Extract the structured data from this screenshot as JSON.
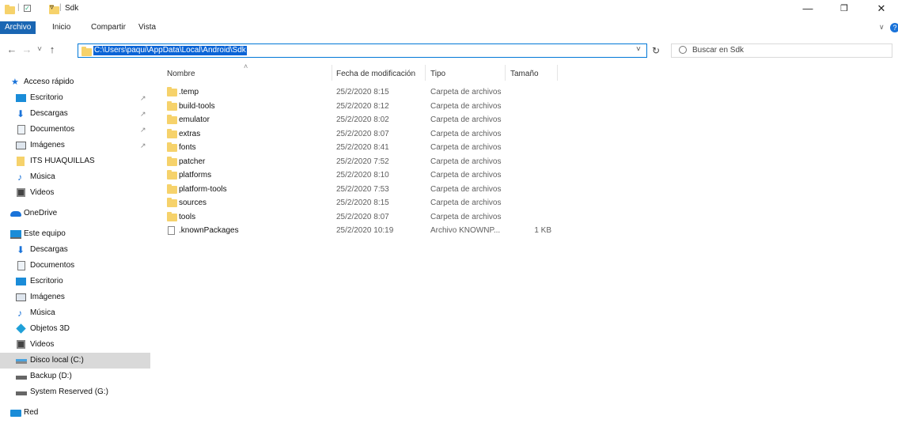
{
  "window": {
    "title": "Sdk",
    "qat_separator": "|",
    "qat_dropdown": "▿",
    "minimize": "—",
    "restore": "❐",
    "close": "✕",
    "ribbon_expand": "∨",
    "help": "?"
  },
  "ribbon": {
    "tabs": [
      {
        "label": "Archivo",
        "active": true
      },
      {
        "label": "Inicio",
        "active": false
      },
      {
        "label": "Compartir",
        "active": false
      },
      {
        "label": "Vista",
        "active": false
      }
    ]
  },
  "nav": {
    "back": "←",
    "forward": "→",
    "recent": "˅",
    "up": "↑",
    "address": "C:\\Users\\paqui\\AppData\\Local\\Android\\Sdk",
    "address_dropdown": "˅",
    "refresh": "↻",
    "search_placeholder": "Buscar en Sdk"
  },
  "sidebar": {
    "items": [
      {
        "label": "Acceso rápido",
        "icon": "star-icon",
        "pinned": false,
        "indent": 0
      },
      {
        "label": "Escritorio",
        "icon": "desktop-icon",
        "pinned": true,
        "indent": 1
      },
      {
        "label": "Descargas",
        "icon": "download-icon",
        "pinned": true,
        "indent": 1
      },
      {
        "label": "Documentos",
        "icon": "document-icon",
        "pinned": true,
        "indent": 1
      },
      {
        "label": "Imágenes",
        "icon": "pictures-icon",
        "pinned": true,
        "indent": 1
      },
      {
        "label": "ITS HUAQUILLAS",
        "icon": "folder-icon",
        "pinned": false,
        "indent": 1
      },
      {
        "label": "Música",
        "icon": "music-icon",
        "pinned": false,
        "indent": 1
      },
      {
        "label": "Videos",
        "icon": "video-icon",
        "pinned": false,
        "indent": 1
      },
      {
        "label": "OneDrive",
        "icon": "cloud-icon",
        "pinned": false,
        "indent": 0
      },
      {
        "label": "Este equipo",
        "icon": "computer-icon",
        "pinned": false,
        "indent": 0
      },
      {
        "label": "Descargas",
        "icon": "download-icon",
        "pinned": false,
        "indent": 1
      },
      {
        "label": "Documentos",
        "icon": "document-icon",
        "pinned": false,
        "indent": 1
      },
      {
        "label": "Escritorio",
        "icon": "desktop-icon",
        "pinned": false,
        "indent": 1
      },
      {
        "label": "Imágenes",
        "icon": "pictures-icon",
        "pinned": false,
        "indent": 1
      },
      {
        "label": "Música",
        "icon": "music-icon",
        "pinned": false,
        "indent": 1
      },
      {
        "label": "Objetos 3D",
        "icon": "cube-icon",
        "pinned": false,
        "indent": 1
      },
      {
        "label": "Videos",
        "icon": "video-icon",
        "pinned": false,
        "indent": 1
      },
      {
        "label": "Disco local (C:)",
        "icon": "drive-icon",
        "pinned": false,
        "indent": 1,
        "selected": true
      },
      {
        "label": "Backup (D:)",
        "icon": "drive-icon",
        "pinned": false,
        "indent": 1
      },
      {
        "label": "System Reserved (G:)",
        "icon": "drive-icon",
        "pinned": false,
        "indent": 1
      },
      {
        "label": "Red",
        "icon": "network-icon",
        "pinned": false,
        "indent": 0
      }
    ],
    "pin_glyph": "↗"
  },
  "columns": {
    "sort_indicator": "˄",
    "name": "Nombre",
    "date": "Fecha de modificación",
    "type": "Tipo",
    "size": "Tamaño"
  },
  "files": [
    {
      "name": ".temp",
      "date": "25/2/2020 8:15",
      "type": "Carpeta de archivos",
      "size": "",
      "kind": "folder"
    },
    {
      "name": "build-tools",
      "date": "25/2/2020 8:12",
      "type": "Carpeta de archivos",
      "size": "",
      "kind": "folder"
    },
    {
      "name": "emulator",
      "date": "25/2/2020 8:02",
      "type": "Carpeta de archivos",
      "size": "",
      "kind": "folder"
    },
    {
      "name": "extras",
      "date": "25/2/2020 8:07",
      "type": "Carpeta de archivos",
      "size": "",
      "kind": "folder"
    },
    {
      "name": "fonts",
      "date": "25/2/2020 8:41",
      "type": "Carpeta de archivos",
      "size": "",
      "kind": "folder"
    },
    {
      "name": "patcher",
      "date": "25/2/2020 7:52",
      "type": "Carpeta de archivos",
      "size": "",
      "kind": "folder"
    },
    {
      "name": "platforms",
      "date": "25/2/2020 8:10",
      "type": "Carpeta de archivos",
      "size": "",
      "kind": "folder"
    },
    {
      "name": "platform-tools",
      "date": "25/2/2020 7:53",
      "type": "Carpeta de archivos",
      "size": "",
      "kind": "folder"
    },
    {
      "name": "sources",
      "date": "25/2/2020 8:15",
      "type": "Carpeta de archivos",
      "size": "",
      "kind": "folder"
    },
    {
      "name": "tools",
      "date": "25/2/2020 8:07",
      "type": "Carpeta de archivos",
      "size": "",
      "kind": "folder"
    },
    {
      "name": ".knownPackages",
      "date": "25/2/2020 10:19",
      "type": "Archivo KNOWNP...",
      "size": "1 KB",
      "kind": "file"
    }
  ],
  "colors": {
    "accent": "#1a66b3",
    "selection": "#0a64d6",
    "folder": "#f6d26b"
  }
}
